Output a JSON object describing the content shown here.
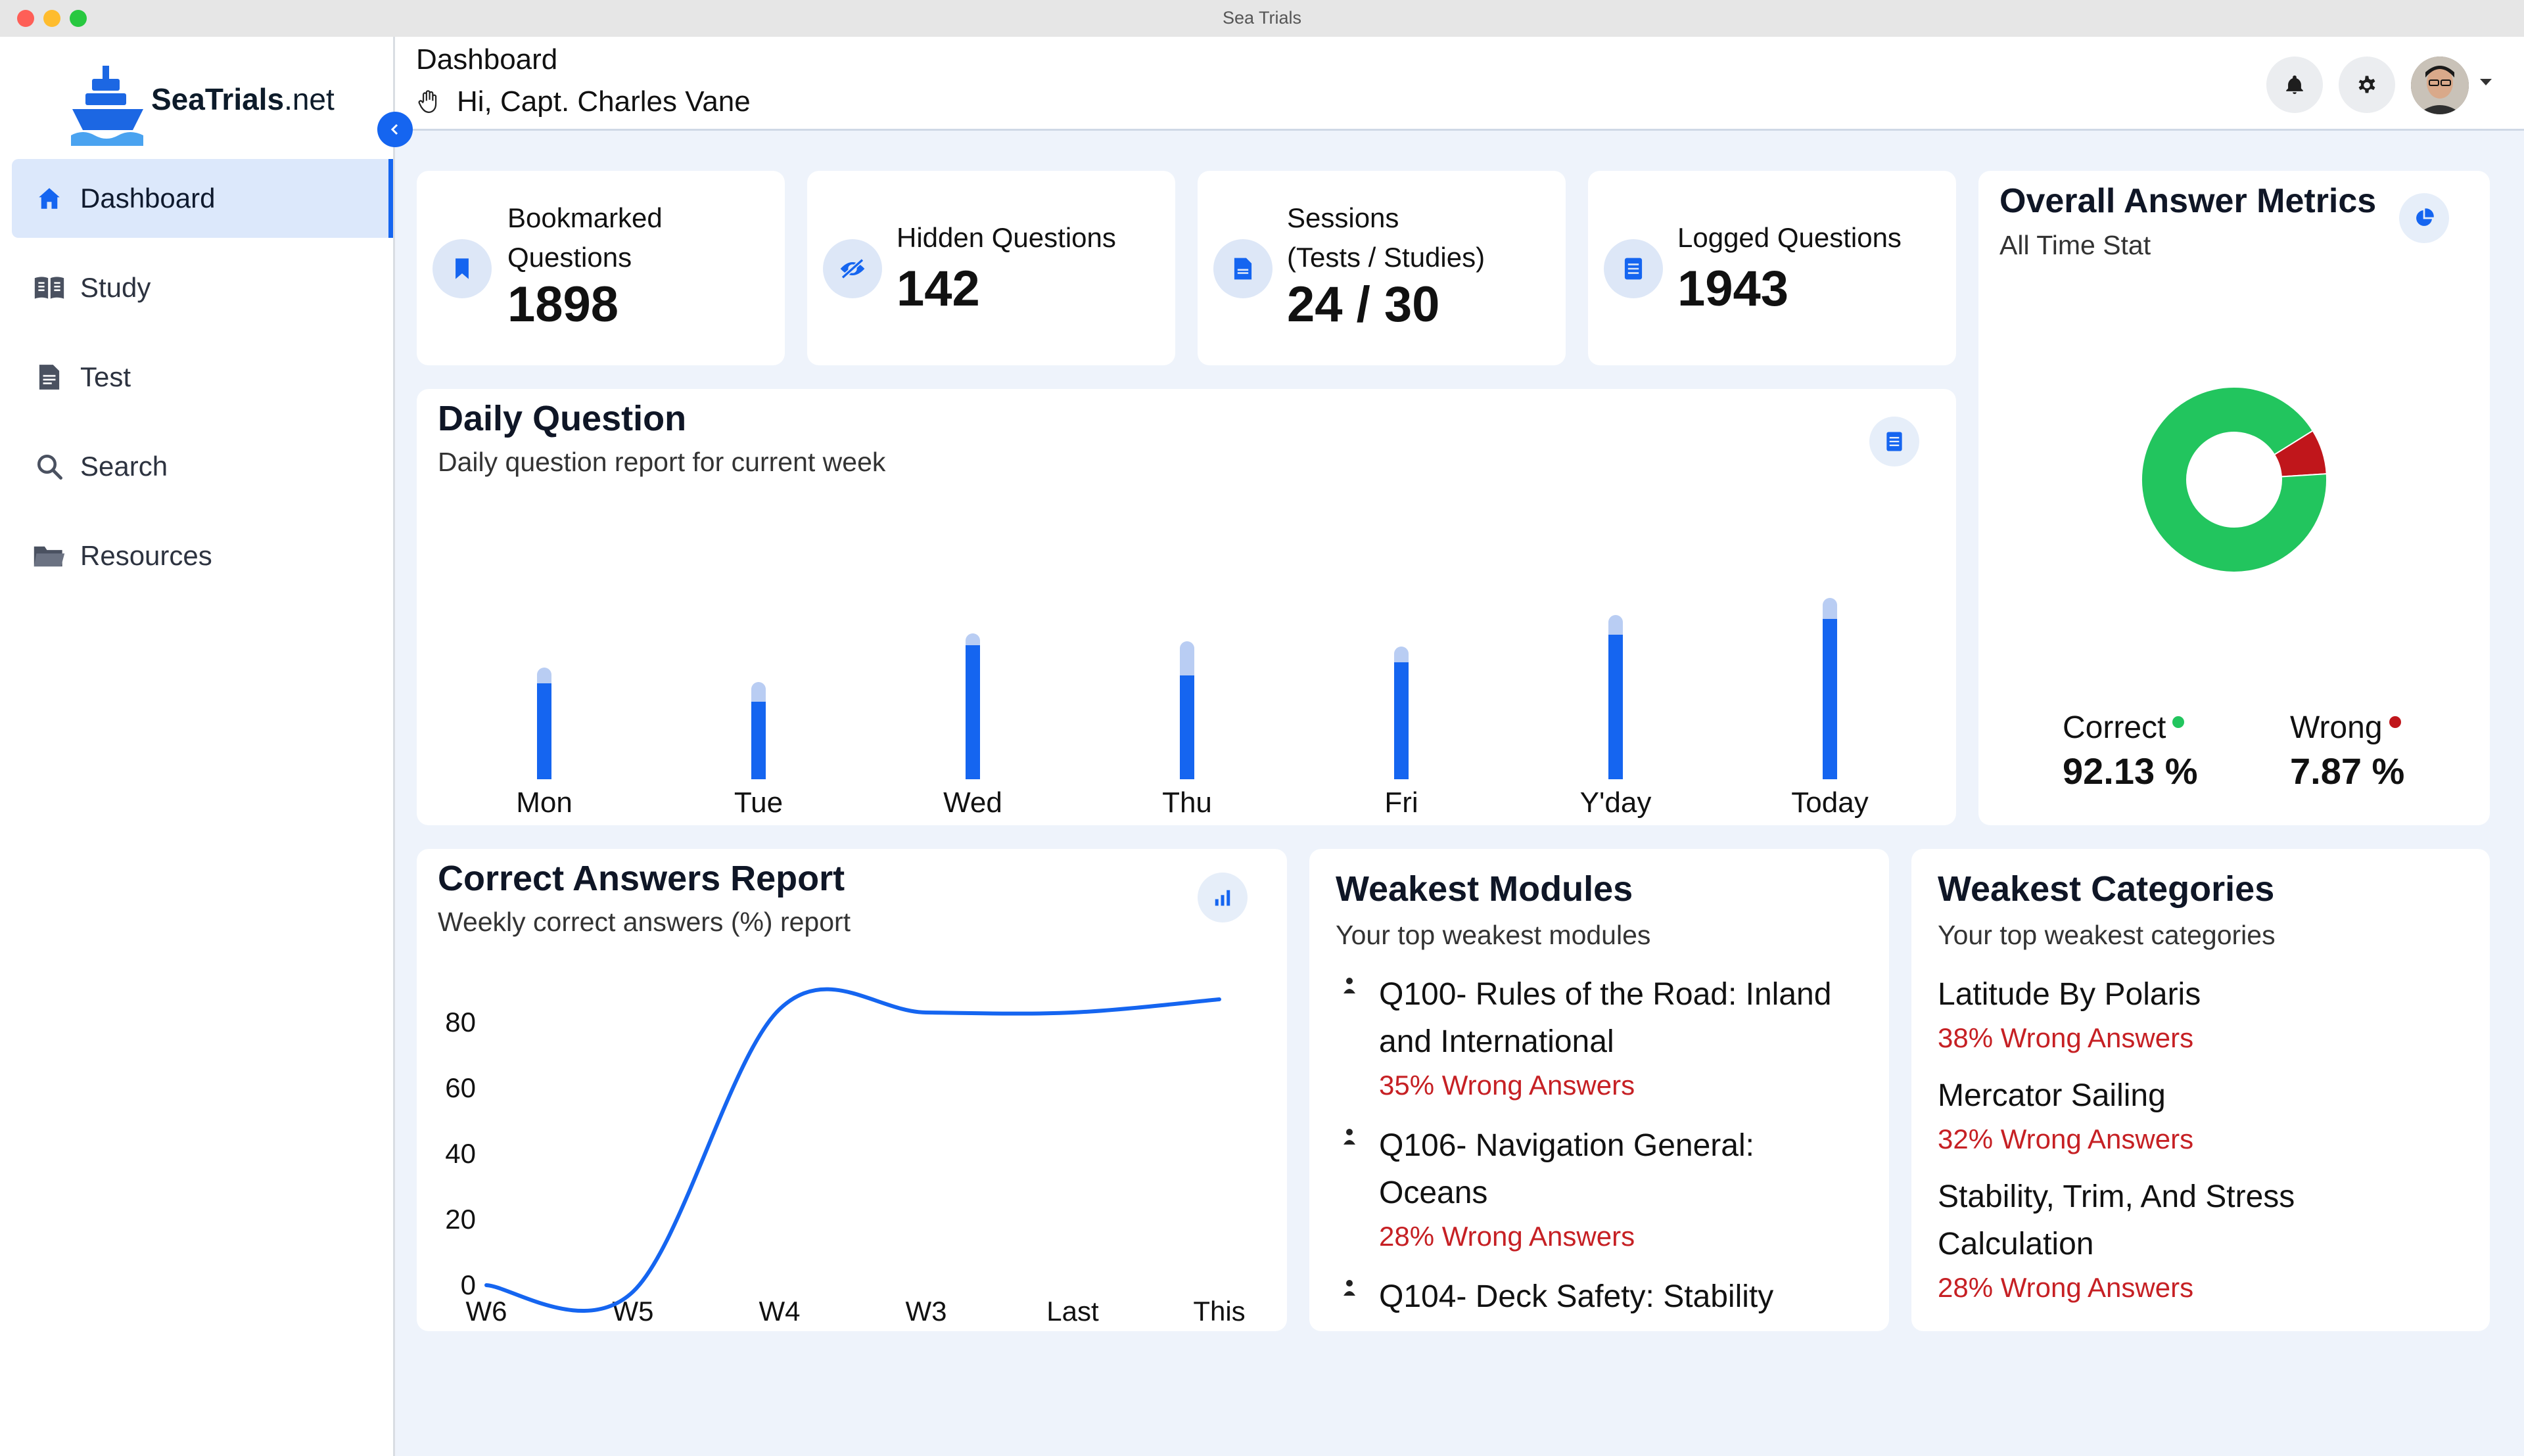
{
  "window": {
    "title": "Sea Trials"
  },
  "logo": {
    "brand_bold": "Sea",
    "brand_bold2": "Trials",
    "brand_rest": ".net"
  },
  "sidebar": {
    "items": [
      {
        "label": "Dashboard",
        "icon": "home-icon",
        "active": true
      },
      {
        "label": "Study",
        "icon": "book-icon"
      },
      {
        "label": "Test",
        "icon": "document-icon"
      },
      {
        "label": "Search",
        "icon": "search-icon"
      },
      {
        "label": "Resources",
        "icon": "folder-icon"
      }
    ]
  },
  "header": {
    "title": "Dashboard",
    "greeting": "Hi, Capt. Charles Vane"
  },
  "stats": [
    {
      "label_line1": "Bookmarked",
      "label_line2": "Questions",
      "value": "1898",
      "icon": "bookmark-icon"
    },
    {
      "label_line1": "Hidden Questions",
      "value": "142",
      "icon": "eye-off-icon"
    },
    {
      "label_line1": "Sessions",
      "label_line2": "(Tests / Studies)",
      "value": "24 / 30",
      "icon": "file-icon"
    },
    {
      "label_line1": "Logged Questions",
      "value": "1943",
      "icon": "list-icon"
    }
  ],
  "metrics": {
    "title": "Overall Answer Metrics",
    "subtitle": "All Time Stat",
    "correct_label": "Correct",
    "correct_value": "92.13 %",
    "wrong_label": "Wrong",
    "wrong_value": "7.87 %",
    "colors": {
      "correct": "#22c55e",
      "wrong": "#c0161b"
    }
  },
  "daily": {
    "title": "Daily Question",
    "subtitle": "Daily question report for current week"
  },
  "report": {
    "title": "Correct Answers Report",
    "subtitle": "Weekly correct answers (%) report"
  },
  "weak_modules": {
    "title": "Weakest Modules",
    "subtitle": "Your top weakest modules",
    "items": [
      {
        "name": "Q100- Rules of the Road: Inland and International",
        "pct": "35% Wrong Answers"
      },
      {
        "name": "Q106- Navigation General: Oceans",
        "pct": "28% Wrong Answers"
      },
      {
        "name": "Q104- Deck Safety: Stability",
        "pct": ""
      }
    ]
  },
  "weak_categories": {
    "title": "Weakest Categories",
    "subtitle": "Your top weakest categories",
    "items": [
      {
        "name": "Latitude By Polaris",
        "pct": "38% Wrong Answers"
      },
      {
        "name": "Mercator Sailing",
        "pct": "32% Wrong Answers"
      },
      {
        "name": "Stability, Trim, And Stress Calculation",
        "pct": "28% Wrong Answers"
      }
    ]
  },
  "chart_data": [
    {
      "type": "bar",
      "categories": [
        "Mon",
        "Tue",
        "Wed",
        "Thu",
        "Fri",
        "Y'day",
        "Today"
      ],
      "series": [
        {
          "values": [
            73,
            59,
            102,
            79,
            89,
            110,
            122
          ]
        },
        {
          "values": [
            12,
            15,
            9,
            26,
            12,
            15,
            16
          ]
        }
      ],
      "ylim": [
        0,
        140
      ],
      "colors": [
        "#1565f0",
        "#b9cdf3"
      ]
    },
    {
      "type": "line",
      "categories": [
        "W6",
        "W5",
        "W4",
        "W3",
        "Last",
        "This"
      ],
      "x": [
        0,
        1,
        2,
        3,
        4,
        5
      ],
      "series": [
        {
          "values": [
            0,
            -2,
            84,
            83,
            83,
            87
          ]
        }
      ],
      "yticks": [
        0,
        20,
        40,
        60,
        80
      ],
      "ylim": [
        0,
        90
      ],
      "colors": [
        "#1565f0"
      ]
    },
    {
      "type": "pie",
      "labels": [
        "Correct",
        "Wrong"
      ],
      "values": [
        92.13,
        7.87
      ],
      "colors": [
        "#22c55e",
        "#c0161b"
      ]
    }
  ]
}
